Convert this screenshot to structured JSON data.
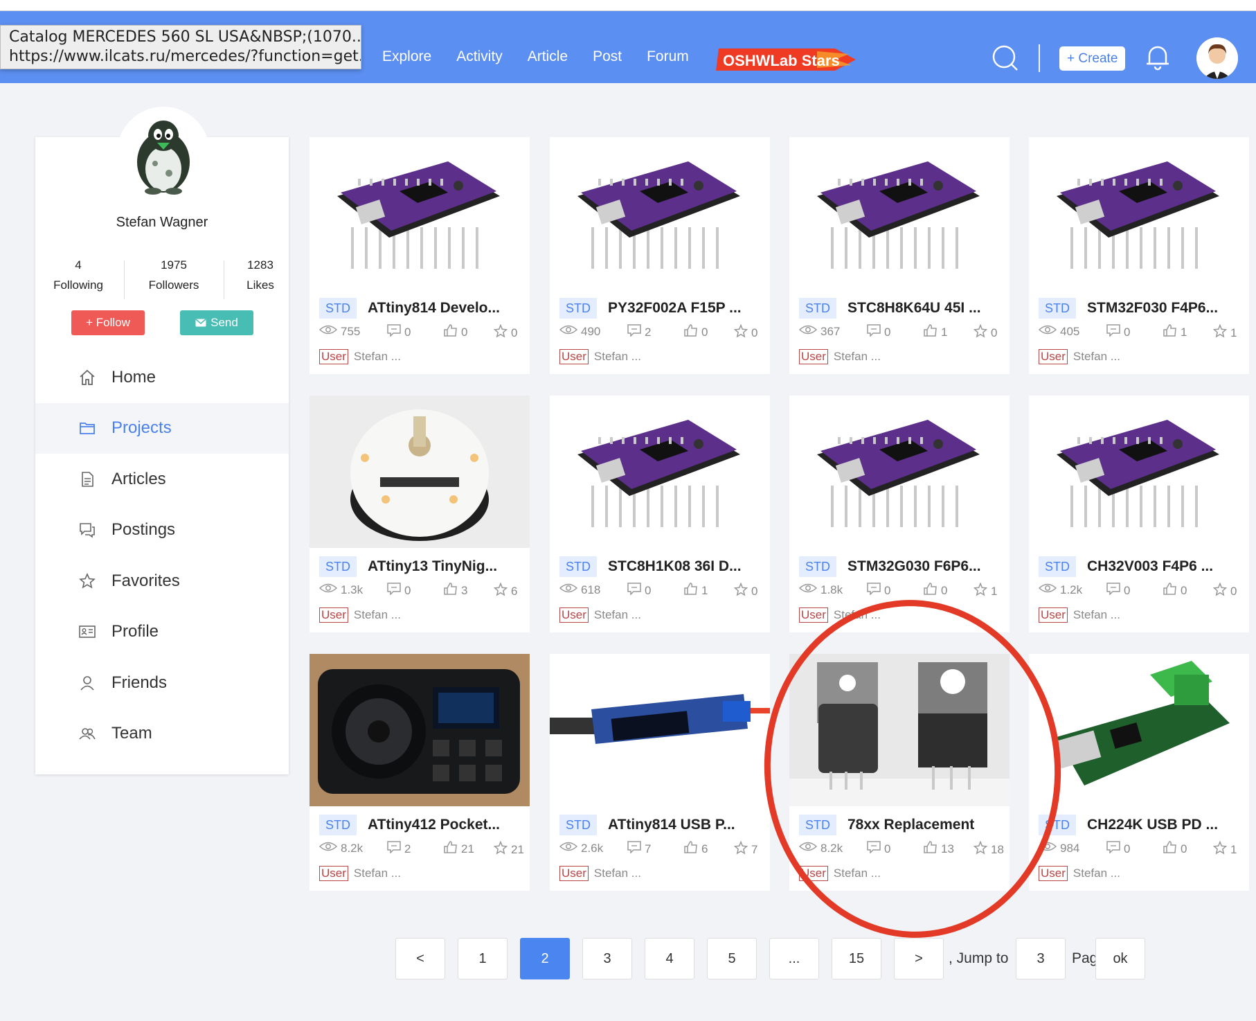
{
  "tooltip": {
    "line1": "Catalog MERCEDES 560 SL USA&NBSP;(1070...",
    "line2": "https://www.ilcats.ru/mercedes/?function=get..."
  },
  "nav": [
    "Explore",
    "Activity",
    "Article",
    "Post",
    "Forum"
  ],
  "stars_logo": "OSHWLab Stars",
  "create_label": "+ Create",
  "profile": {
    "name": "Stefan Wagner",
    "following": "4",
    "following_label": "Following",
    "followers": "1975",
    "followers_label": "Followers",
    "likes": "1283",
    "likes_label": "Likes",
    "follow_label": "+ Follow",
    "send_label": "Send"
  },
  "menu": [
    {
      "label": "Home",
      "icon": "home-icon"
    },
    {
      "label": "Projects",
      "icon": "folder-icon"
    },
    {
      "label": "Articles",
      "icon": "document-icon"
    },
    {
      "label": "Postings",
      "icon": "chat-icon"
    },
    {
      "label": "Favorites",
      "icon": "star-icon"
    },
    {
      "label": "Profile",
      "icon": "id-card-icon"
    },
    {
      "label": "Friends",
      "icon": "person-icon"
    },
    {
      "label": "Team",
      "icon": "team-icon"
    }
  ],
  "cards": [
    {
      "tag": "STD",
      "title": "ATtiny814 Develo...",
      "views": "755",
      "comments": "0",
      "likes": "0",
      "stars": "0",
      "user_tag": "User",
      "owner": "Stefan ...",
      "thumb": "purple"
    },
    {
      "tag": "STD",
      "title": "PY32F002A F15P ...",
      "views": "490",
      "comments": "2",
      "likes": "0",
      "stars": "0",
      "user_tag": "User",
      "owner": "Stefan ...",
      "thumb": "purple"
    },
    {
      "tag": "STD",
      "title": "STC8H8K64U 45I ...",
      "views": "367",
      "comments": "0",
      "likes": "1",
      "stars": "0",
      "user_tag": "User",
      "owner": "Stefan ...",
      "thumb": "purple"
    },
    {
      "tag": "STD",
      "title": "STM32F030 F4P6...",
      "views": "405",
      "comments": "0",
      "likes": "1",
      "stars": "1",
      "user_tag": "User",
      "owner": "Stefan ...",
      "thumb": "purple"
    },
    {
      "tag": "STD",
      "title": "ATtiny13 TinyNig...",
      "views": "1.3k",
      "comments": "0",
      "likes": "3",
      "stars": "6",
      "user_tag": "User",
      "owner": "Stefan ...",
      "thumb": "round"
    },
    {
      "tag": "STD",
      "title": "STC8H1K08 36I D...",
      "views": "618",
      "comments": "0",
      "likes": "1",
      "stars": "0",
      "user_tag": "User",
      "owner": "Stefan ...",
      "thumb": "purple"
    },
    {
      "tag": "STD",
      "title": "STM32G030 F6P6...",
      "views": "1.8k",
      "comments": "0",
      "likes": "0",
      "stars": "1",
      "user_tag": "User",
      "owner": "Stefan ...",
      "thumb": "purple"
    },
    {
      "tag": "STD",
      "title": "CH32V003 F4P6 ...",
      "views": "1.2k",
      "comments": "0",
      "likes": "0",
      "stars": "0",
      "user_tag": "User",
      "owner": "Stefan ...",
      "thumb": "purple"
    },
    {
      "tag": "STD",
      "title": "ATtiny412 Pocket...",
      "views": "8.2k",
      "comments": "2",
      "likes": "21",
      "stars": "21",
      "user_tag": "User",
      "owner": "Stefan ...",
      "thumb": "radio"
    },
    {
      "tag": "STD",
      "title": "ATtiny814 USB P...",
      "views": "2.6k",
      "comments": "7",
      "likes": "6",
      "stars": "7",
      "user_tag": "User",
      "owner": "Stefan ...",
      "thumb": "usb"
    },
    {
      "tag": "STD",
      "title": "78xx Replacement",
      "views": "8.2k",
      "comments": "0",
      "likes": "13",
      "stars": "18",
      "user_tag": "User",
      "owner": "Stefan ...",
      "thumb": "regulator"
    },
    {
      "tag": "STD",
      "title": "CH224K USB PD ...",
      "views": "984",
      "comments": "0",
      "likes": "0",
      "stars": "1",
      "user_tag": "User",
      "owner": "Stefan ...",
      "thumb": "greenpcb"
    }
  ],
  "pagination": {
    "prev": "<",
    "pages": [
      "1",
      "2",
      "3",
      "4",
      "5",
      "...",
      "15"
    ],
    "active_page": "2",
    "next": ">",
    "jump_label": ", Jump to",
    "jump_value": "3",
    "page_label": "Page",
    "ok_label": "ok"
  },
  "colors": {
    "header": "#5b8ff1",
    "accent": "#4b85ef",
    "follow": "#ef5a57",
    "send": "#47bdb4",
    "highlight_circle": "#e23a26"
  }
}
